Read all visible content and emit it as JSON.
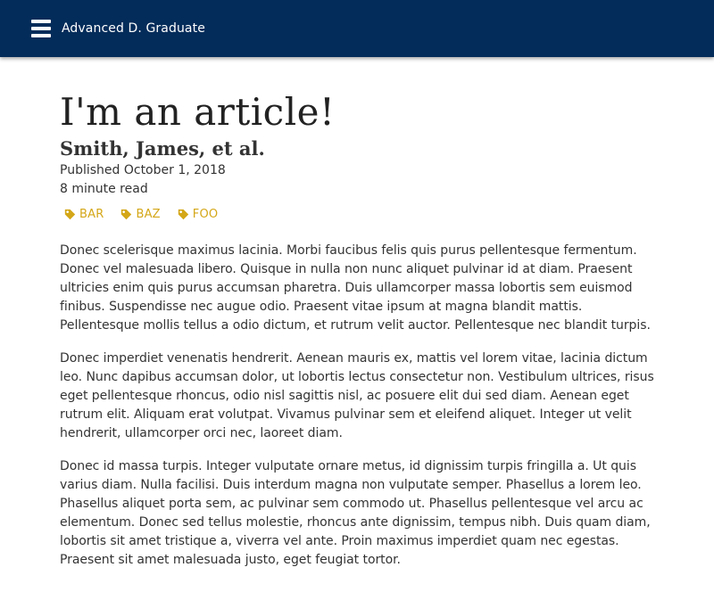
{
  "header": {
    "site_title": "Advanced D. Graduate",
    "menu_icon": "hamburger-menu-icon",
    "background_color": "#042c5a"
  },
  "article": {
    "title": "I'm an article!",
    "authors": "Smith, James, et al.",
    "published": "Published October 1, 2018",
    "read_time": "8 minute read",
    "tag_color": "#d4a718",
    "tag_icon": "tag-icon",
    "tags": [
      {
        "label": "BAR"
      },
      {
        "label": "BAZ"
      },
      {
        "label": "FOO"
      }
    ],
    "paragraphs": [
      "Donec scelerisque maximus lacinia. Morbi faucibus felis quis purus pellentesque fermentum. Donec vel malesuada libero. Quisque in nulla non nunc aliquet pulvinar id at diam. Praesent ultricies enim quis purus accumsan pharetra. Duis ullamcorper massa lobortis sem euismod finibus. Suspendisse nec augue odio. Praesent vitae ipsum at magna blandit mattis. Pellentesque mollis tellus a odio dictum, et rutrum velit auctor. Pellentesque nec blandit turpis.",
      "Donec imperdiet venenatis hendrerit. Aenean mauris ex, mattis vel lorem vitae, lacinia dictum leo. Nunc dapibus accumsan dolor, ut lobortis lectus consectetur non. Vestibulum ultrices, risus eget pellentesque rhoncus, odio nisl sagittis nisl, ac posuere elit dui sed diam. Aenean eget rutrum elit. Aliquam erat volutpat. Vivamus pulvinar sem et eleifend aliquet. Integer ut velit hendrerit, ullamcorper orci nec, laoreet diam.",
      "Donec id massa turpis. Integer vulputate ornare metus, id dignissim turpis fringilla a. Ut quis varius diam. Nulla facilisi. Duis interdum magna non vulputate semper. Phasellus a lorem leo. Phasellus aliquet porta sem, ac pulvinar sem commodo ut. Phasellus pellentesque vel arcu ac elementum. Donec sed tellus molestie, rhoncus ante dignissim, tempus nibh. Duis quam diam, lobortis sit amet tristique a, viverra vel ante. Proin maximus imperdiet quam nec egestas. Praesent sit amet malesuada justo, eget feugiat tortor."
    ]
  }
}
